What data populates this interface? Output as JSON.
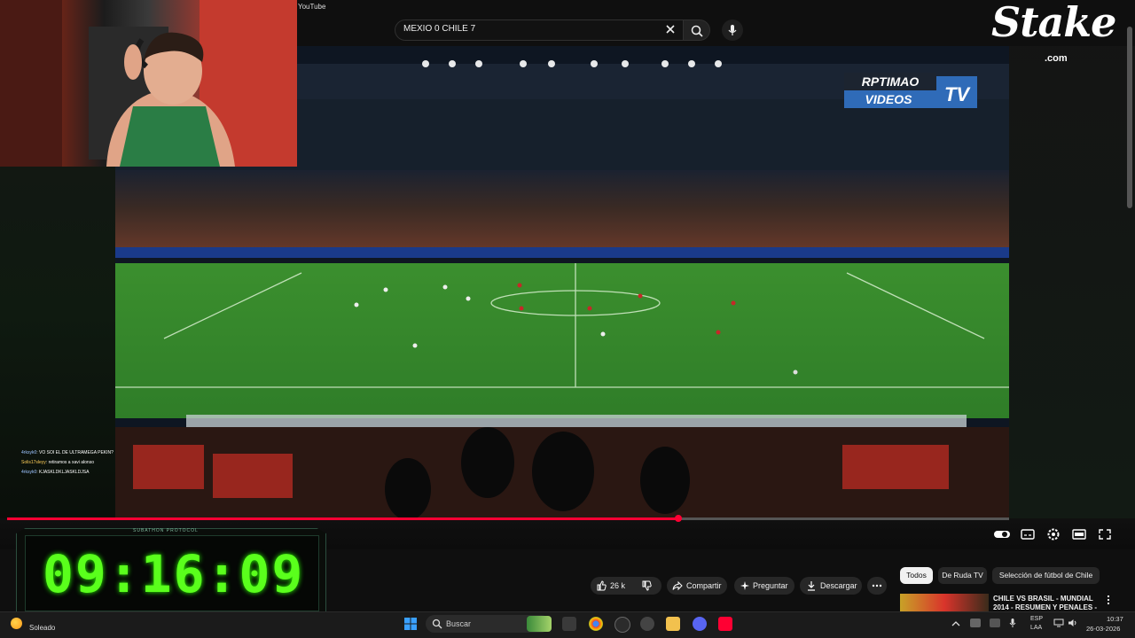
{
  "window": {
    "app_title": "YouTube"
  },
  "search": {
    "query": "MEXIO 0 CHILE 7"
  },
  "brand": {
    "logo_text": "Stake",
    "logo_domain": ".com"
  },
  "video": {
    "watermark_line1": "RPTIMAO",
    "watermark_line2": "VIDEOS",
    "watermark_tv": "TV",
    "progress_fraction": 0.67
  },
  "chat": [
    {
      "user": "4rksyk0",
      "message": ": VO SOI EL DE ULTRAMEGA PEKIN?"
    },
    {
      "user": "Solis17sleyy",
      "message": ": retiramos a xavi alonso"
    },
    {
      "user": "4rksyk0",
      "message": ": KJASKLDKLJASKLDJSA"
    }
  ],
  "timer": {
    "label": "SUBATHON PROTOCOL",
    "value": "09:16:09"
  },
  "actions": {
    "likes": "26 k",
    "share": "Compartir",
    "ask": "Preguntar",
    "download": "Descargar"
  },
  "chips": [
    "Todos",
    "De Ruda TV",
    "Selección de fútbol de Chile"
  ],
  "recommendation": {
    "title": "CHILE VS BRASIL - MUNDIAL 2014 - RESUMEN Y PENALES -"
  },
  "taskbar": {
    "weather": "Soleado",
    "search_placeholder": "Buscar",
    "lang1": "ESP",
    "lang2": "LAA",
    "time": "10:37",
    "date": "26-03-2026"
  },
  "colors": {
    "accent_red": "#ff0033",
    "timer_green": "#5aff1c",
    "chat_user": "#9dc3ff"
  }
}
